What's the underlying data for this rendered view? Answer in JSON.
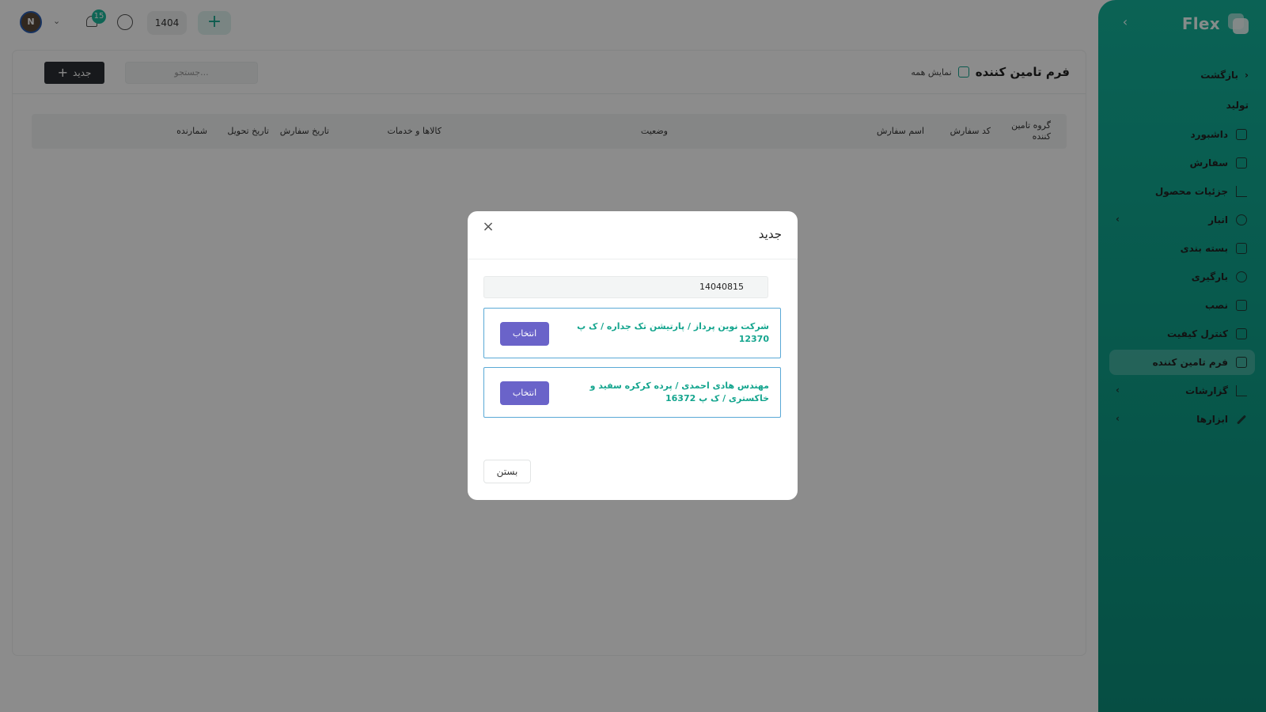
{
  "sidebar": {
    "brand": "Flex",
    "back_label": "بازگشت",
    "section_label": "تولید",
    "items": [
      {
        "label": "داشبورد",
        "icon": "home-icon",
        "active": false,
        "has_submenu": false
      },
      {
        "label": "سفارش",
        "icon": "order-icon",
        "active": false,
        "has_submenu": false
      },
      {
        "label": "جزئیات محصول",
        "icon": "chart-icon",
        "active": false,
        "has_submenu": false
      },
      {
        "label": "انبار",
        "icon": "warehouse-icon",
        "active": false,
        "has_submenu": true
      },
      {
        "label": "بسته بندی",
        "icon": "package-icon",
        "active": false,
        "has_submenu": false
      },
      {
        "label": "بارگیری",
        "icon": "loading-icon",
        "active": false,
        "has_submenu": false
      },
      {
        "label": "نصب",
        "icon": "install-icon",
        "active": false,
        "has_submenu": false
      },
      {
        "label": "کنترل کیفیت",
        "icon": "quality-icon",
        "active": false,
        "has_submenu": false
      },
      {
        "label": "فرم تامین کننده",
        "icon": "form-icon",
        "active": true,
        "has_submenu": false
      },
      {
        "label": "گزارشات",
        "icon": "report-icon",
        "active": false,
        "has_submenu": true
      },
      {
        "label": "ابزارها",
        "icon": "pen-icon",
        "active": false,
        "has_submenu": true
      }
    ]
  },
  "topbar": {
    "notification_count": "15",
    "year": "1404",
    "add_icon": "+"
  },
  "page": {
    "title": "فرم تامین کننده",
    "show_all_label": "نمایش همه",
    "search_placeholder": "جستجو...",
    "new_button_label": "جدید"
  },
  "table": {
    "headers": [
      "گروه تامین کننده",
      "کد سفارش",
      "اسم سفارش",
      "وضعیت",
      "کالاها و خدمات",
      "تاریخ سفارش",
      "تاریخ تحویل",
      "شمارنده"
    ]
  },
  "modal": {
    "title": "جدید",
    "input_value": "14040815",
    "options": [
      {
        "text": "شرکت نوین پرداز / پارتیشن تک جداره / ک پ 12370",
        "button_label": "انتخاب"
      },
      {
        "text": "مهندس هادی احمدی / پرده کرکره سفید و خاکستری / ک پ 16372",
        "button_label": "انتخاب"
      }
    ],
    "close_button_label": "بستن"
  },
  "colors": {
    "sidebar_green": "#14b39b",
    "accent_purple": "#6a63c9",
    "option_text_green": "#14a58e",
    "dark_button": "#2b2f33"
  }
}
